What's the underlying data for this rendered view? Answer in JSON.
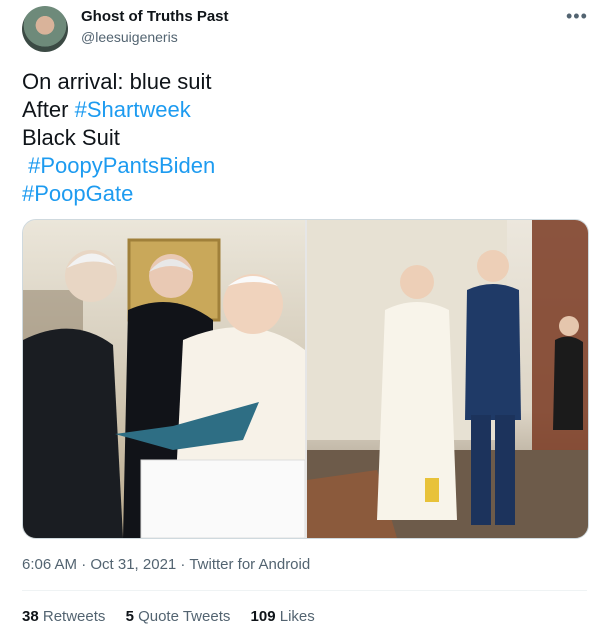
{
  "author": {
    "display_name": "Ghost of Truths Past",
    "handle": "@leesuigeneris"
  },
  "tweet": {
    "lines": [
      {
        "text": "On arrival: blue suit",
        "hashtag": ""
      },
      {
        "text": "After ",
        "hashtag": "#Shartweek"
      },
      {
        "text": "Black Suit",
        "hashtag": ""
      },
      {
        "text": " ",
        "hashtag": "#PoopyPantsBiden"
      },
      {
        "text": "",
        "hashtag": "#PoopGate"
      }
    ]
  },
  "media": {
    "photos": [
      "left-photo",
      "right-photo"
    ]
  },
  "meta": {
    "timestamp": "6:06 AM · Oct 31, 2021 · Twitter for Android"
  },
  "stats": {
    "retweets_count": "38",
    "retweets_label": "Retweets",
    "quotes_count": "5",
    "quotes_label": "Quote Tweets",
    "likes_count": "109",
    "likes_label": "Likes"
  },
  "icons": {
    "more": "more-icon"
  }
}
